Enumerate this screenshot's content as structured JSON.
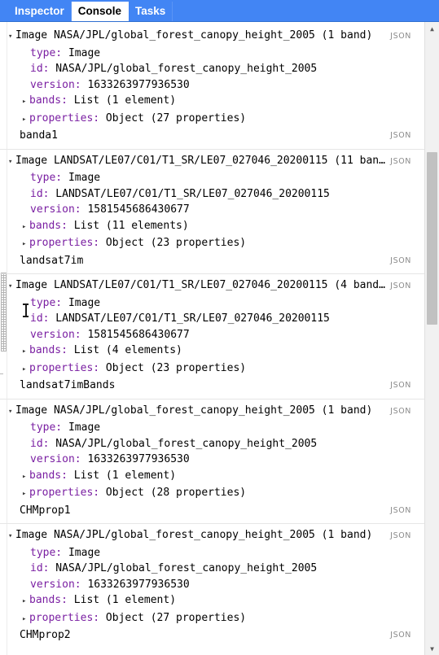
{
  "tabs": [
    {
      "label": "Inspector",
      "active": false
    },
    {
      "label": "Console",
      "active": true
    },
    {
      "label": "Tasks",
      "active": false
    }
  ],
  "json_tag": "JSON",
  "caret_expanded": "▾",
  "caret_collapsed": "▸",
  "colors": {
    "tabbar_blue": "#4285f4",
    "key_purple": "#7a1fa2",
    "json_tag_gray": "#8a8a8a",
    "divider_gray": "#e6e6e6",
    "scroll_thumb": "#c1c1c1",
    "scroll_track": "#f1f1f1"
  },
  "entries": [
    {
      "header": "Image NASA/JPL/global_forest_canopy_height_2005 (1 band)",
      "rows": [
        {
          "key": "type:",
          "value": " Image",
          "node": false
        },
        {
          "key": "id:",
          "value": " NASA/JPL/global_forest_canopy_height_2005",
          "node": false
        },
        {
          "key": "version:",
          "value": " 1633263977936530",
          "node": false
        },
        {
          "key": "bands:",
          "value": " List (1 element)",
          "node": true
        },
        {
          "key": "properties:",
          "value": " Object (27 properties)",
          "node": true
        }
      ],
      "label": "banda1"
    },
    {
      "header": "Image LANDSAT/LE07/C01/T1_SR/LE07_027046_20200115 (11 ban…",
      "rows": [
        {
          "key": "type:",
          "value": " Image",
          "node": false
        },
        {
          "key": "id:",
          "value": " LANDSAT/LE07/C01/T1_SR/LE07_027046_20200115",
          "node": false
        },
        {
          "key": "version:",
          "value": " 1581545686430677",
          "node": false
        },
        {
          "key": "bands:",
          "value": " List (11 elements)",
          "node": true
        },
        {
          "key": "properties:",
          "value": " Object (23 properties)",
          "node": true
        }
      ],
      "label": "landsat7im"
    },
    {
      "header": "Image LANDSAT/LE07/C01/T1_SR/LE07_027046_20200115 (4 band…",
      "rows": [
        {
          "key": "type:",
          "value": " Image",
          "node": false
        },
        {
          "key": "id:",
          "value": " LANDSAT/LE07/C01/T1_SR/LE07_027046_20200115",
          "node": false
        },
        {
          "key": "version:",
          "value": " 1581545686430677",
          "node": false
        },
        {
          "key": "bands:",
          "value": " List (4 elements)",
          "node": true
        },
        {
          "key": "properties:",
          "value": " Object (23 properties)",
          "node": true
        }
      ],
      "label": "landsat7imBands"
    },
    {
      "header": "Image NASA/JPL/global_forest_canopy_height_2005 (1 band)",
      "rows": [
        {
          "key": "type:",
          "value": " Image",
          "node": false
        },
        {
          "key": "id:",
          "value": " NASA/JPL/global_forest_canopy_height_2005",
          "node": false
        },
        {
          "key": "version:",
          "value": " 1633263977936530",
          "node": false
        },
        {
          "key": "bands:",
          "value": " List (1 element)",
          "node": true
        },
        {
          "key": "properties:",
          "value": " Object (28 properties)",
          "node": true
        }
      ],
      "label": "CHMprop1"
    },
    {
      "header": "Image NASA/JPL/global_forest_canopy_height_2005 (1 band)",
      "rows": [
        {
          "key": "type:",
          "value": " Image",
          "node": false
        },
        {
          "key": "id:",
          "value": " NASA/JPL/global_forest_canopy_height_2005",
          "node": false
        },
        {
          "key": "version:",
          "value": " 1633263977936530",
          "node": false
        },
        {
          "key": "bands:",
          "value": " List (1 element)",
          "node": true
        },
        {
          "key": "properties:",
          "value": " Object (27 properties)",
          "node": true
        }
      ],
      "label": "CHMprop2"
    }
  ],
  "scrollbar": {
    "up_arrow": "▲",
    "down_arrow": "▼"
  }
}
